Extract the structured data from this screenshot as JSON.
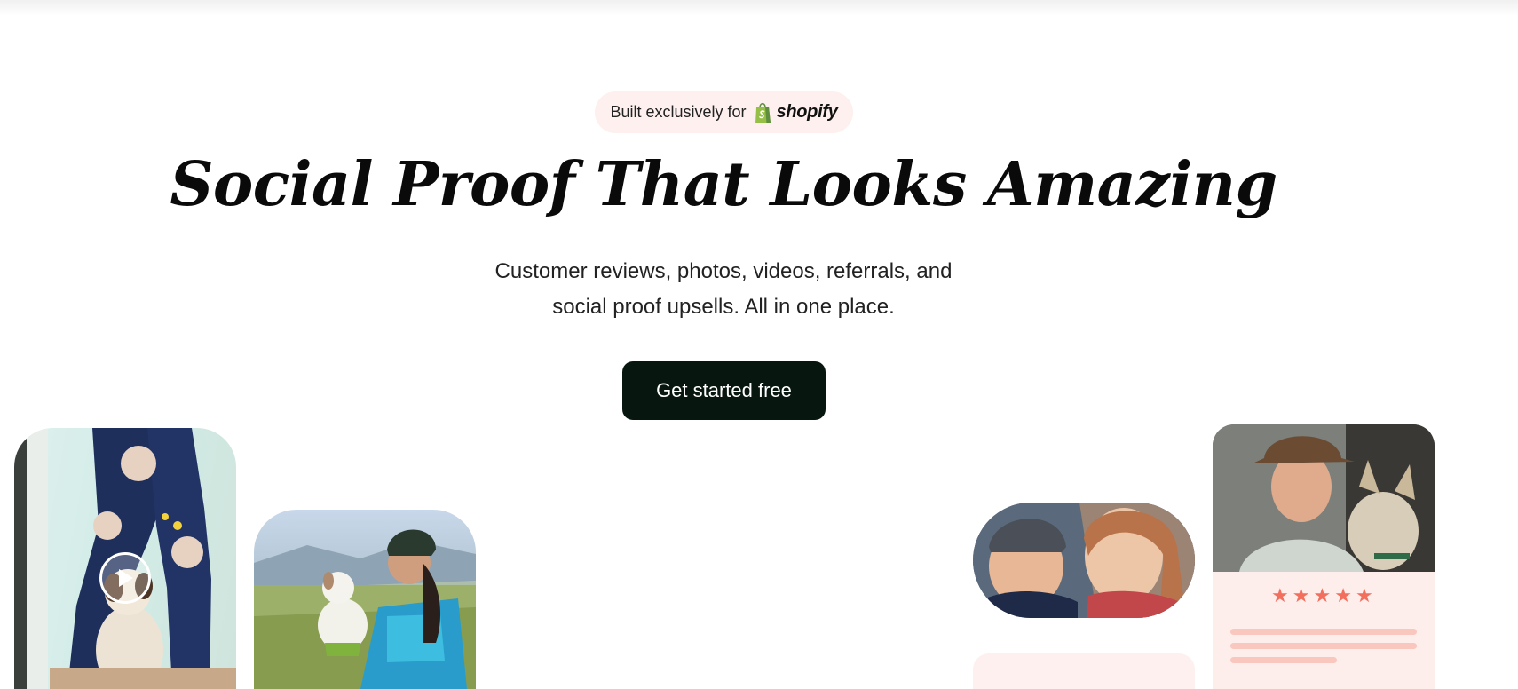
{
  "badge": {
    "prefix": "Built exclusively for",
    "brand": "shopify"
  },
  "hero": {
    "title": "Social Proof That Looks Amazing",
    "subtitle_line1": "Customer reviews, photos, videos, referrals, and",
    "subtitle_line2": "social proof upsells. All in one place.",
    "cta_label": "Get started free"
  },
  "review_card": {
    "rating": 5,
    "star_glyph": "★"
  },
  "icons": {
    "shopify": "shopify-bag-icon",
    "play": "play-icon",
    "star": "star-icon"
  },
  "colors": {
    "cta_background": "#07170f",
    "badge_background": "#fdf0ee",
    "star": "#f26f5e",
    "review_line": "#f9c7bd",
    "shopify_green": "#95bf47"
  }
}
